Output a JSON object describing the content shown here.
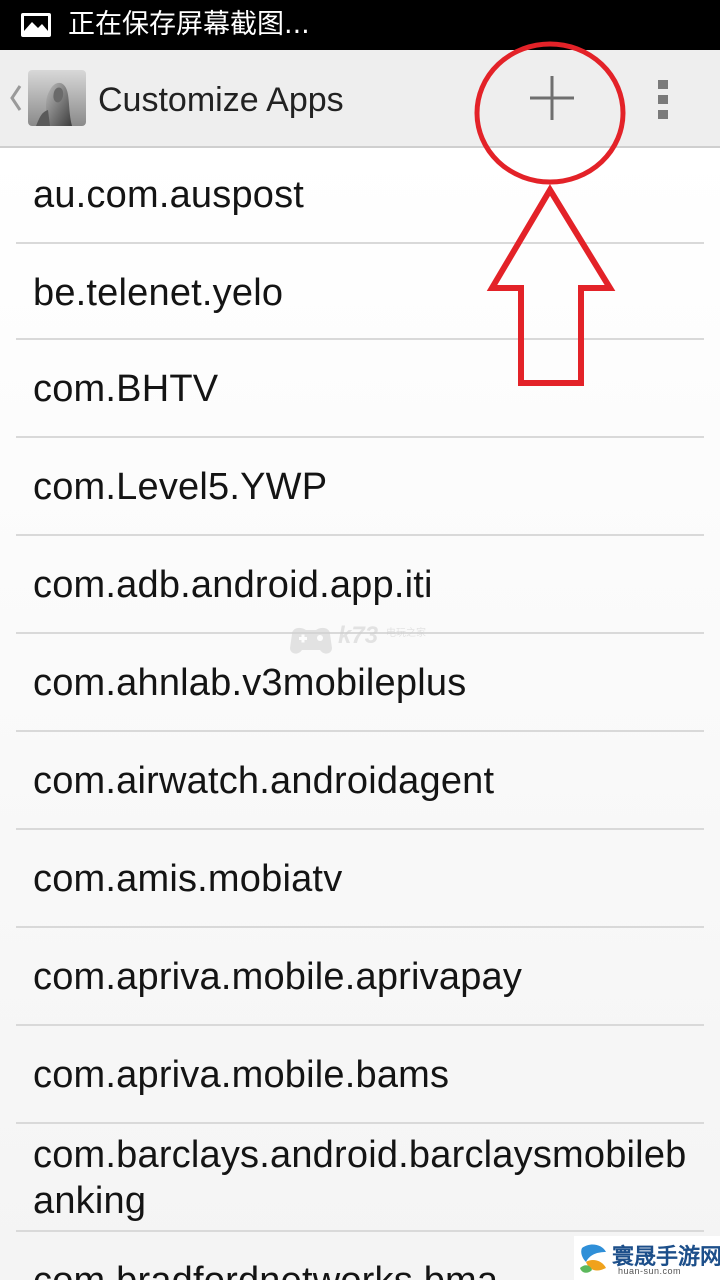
{
  "status_bar": {
    "notification_icon": "image-icon",
    "text": "正在保存屏幕截图..."
  },
  "action_bar": {
    "up_icon": "chevron-left-icon",
    "app_icon": "app-logo-icon",
    "title": "Customize Apps",
    "add_icon": "plus-icon",
    "overflow_icon": "overflow-menu-icon"
  },
  "app_list": {
    "items": [
      {
        "label": "au.com.auspost"
      },
      {
        "label": "be.telenet.yelo"
      },
      {
        "label": "com.BHTV"
      },
      {
        "label": "com.Level5.YWP"
      },
      {
        "label": "com.adb.android.app.iti"
      },
      {
        "label": "com.ahnlab.v3mobileplus"
      },
      {
        "label": "com.airwatch.androidagent"
      },
      {
        "label": "com.amis.mobiatv"
      },
      {
        "label": "com.apriva.mobile.aprivapay"
      },
      {
        "label": "com.apriva.mobile.bams"
      },
      {
        "label": "com.barclays.android.barclaysmobilebanking"
      },
      {
        "label": "com.bradfordnetworks.bma"
      }
    ]
  },
  "annotation": {
    "shape": "red-circle-and-up-arrow",
    "color": "#e32228"
  },
  "watermarks": {
    "center": "k73",
    "center_sub": "电玩之家",
    "corner": "寰晟手游网",
    "corner_sub": "huan-sun.com"
  },
  "colors": {
    "status_bar_bg": "#000000",
    "action_bar_bg": "#eeeeee",
    "list_bg": "#ffffff",
    "divider": "#d9d9d9",
    "annotation_red": "#e32228"
  }
}
